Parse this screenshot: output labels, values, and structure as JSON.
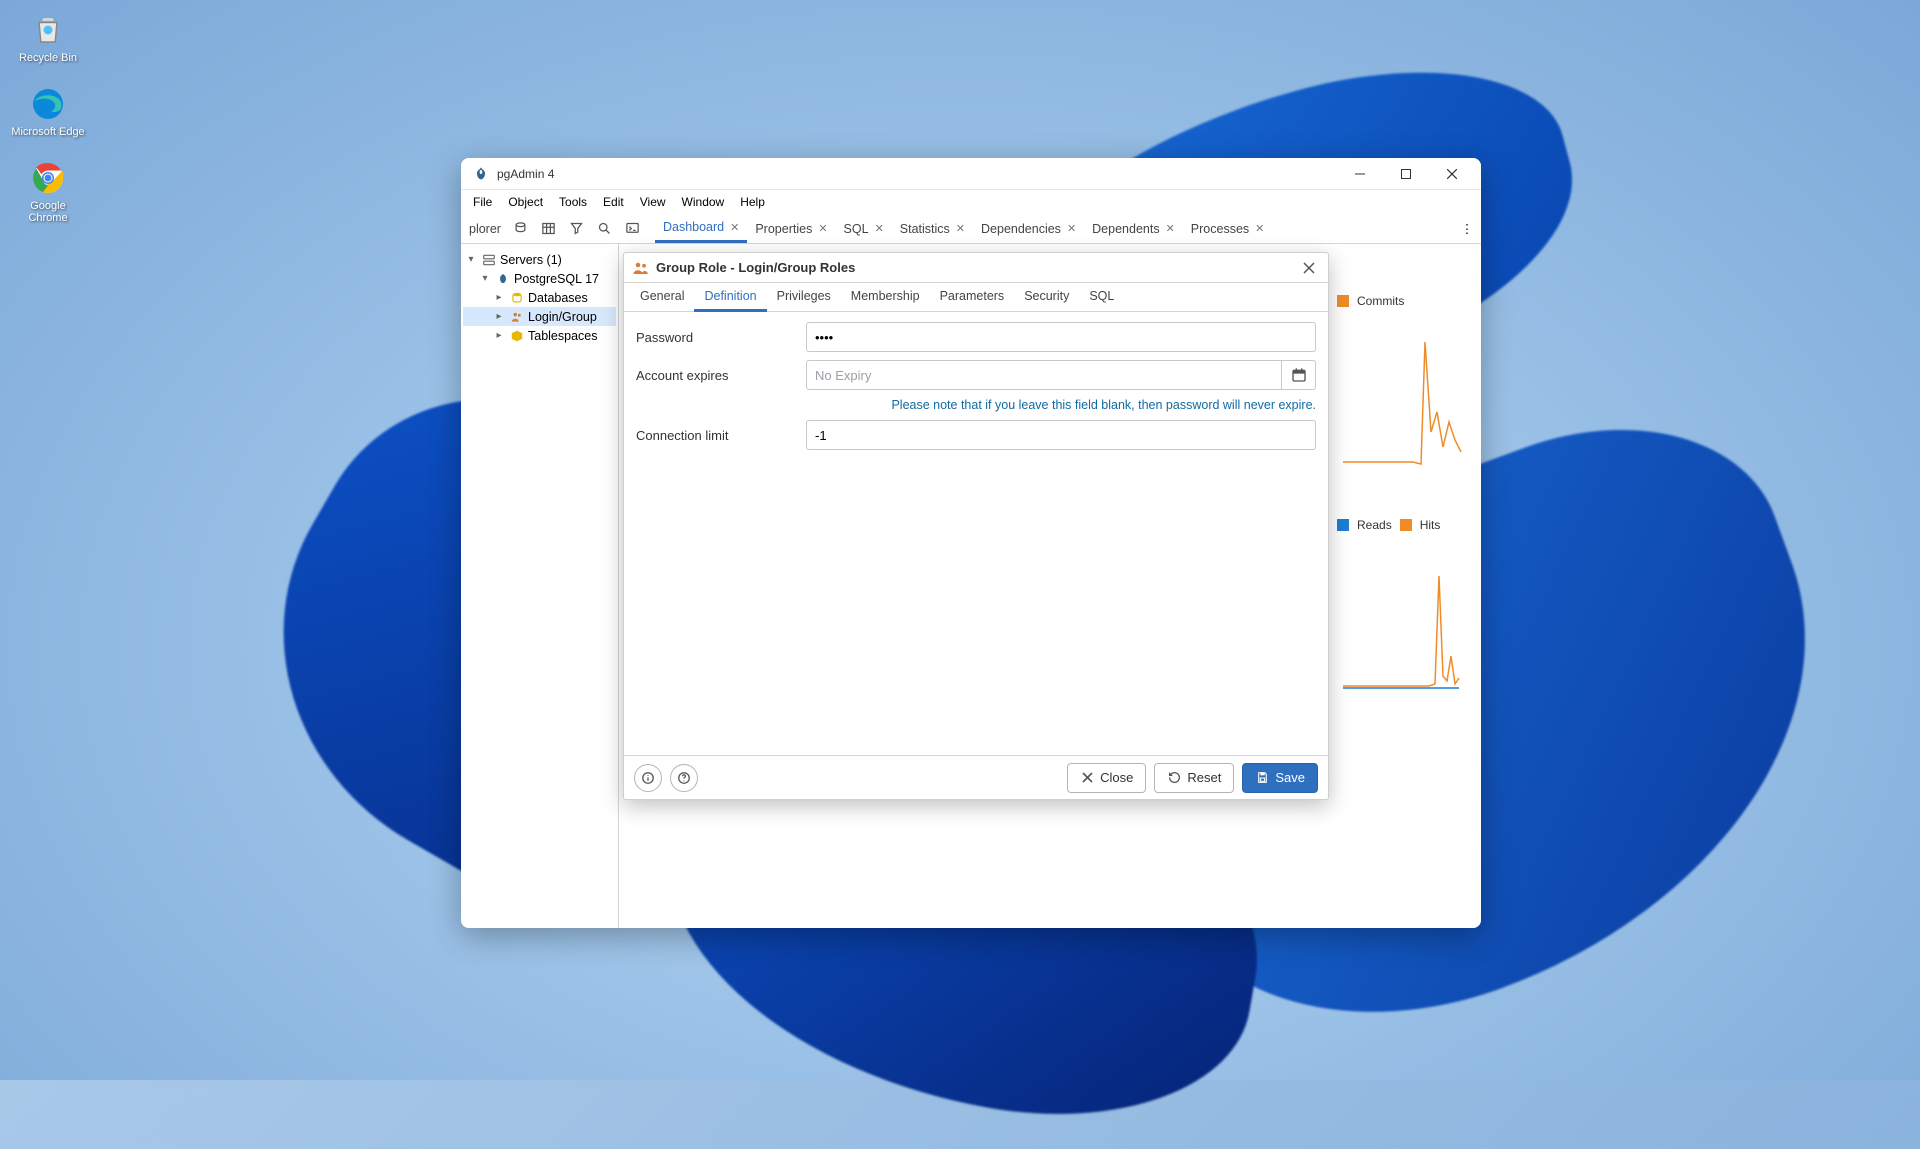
{
  "desktop": {
    "icons": [
      {
        "label": "Recycle Bin",
        "glyph": "🗑️"
      },
      {
        "label": "Microsoft Edge",
        "glyph": "🌐"
      },
      {
        "label": "Google Chrome",
        "glyph": "⭕"
      }
    ]
  },
  "window": {
    "title": "pgAdmin 4",
    "menubar": [
      "File",
      "Object",
      "Tools",
      "Edit",
      "View",
      "Window",
      "Help"
    ],
    "toolbar_label": "plorer",
    "tabs": [
      {
        "label": "Dashboard",
        "active": true
      },
      {
        "label": "Properties",
        "active": false
      },
      {
        "label": "SQL",
        "active": false
      },
      {
        "label": "Statistics",
        "active": false
      },
      {
        "label": "Dependencies",
        "active": false
      },
      {
        "label": "Dependents",
        "active": false
      },
      {
        "label": "Processes",
        "active": false
      }
    ]
  },
  "tree": {
    "root": "Servers (1)",
    "server": "PostgreSQL 17",
    "children": [
      "Databases",
      "Login/Group",
      "Tablespaces"
    ]
  },
  "bg": {
    "legend1": "Commits",
    "legend2a": "Reads",
    "legend2b": "Hits"
  },
  "dialog": {
    "title": "Group Role - Login/Group Roles",
    "tabs": [
      "General",
      "Definition",
      "Privileges",
      "Membership",
      "Parameters",
      "Security",
      "SQL"
    ],
    "active_tab": "Definition",
    "labels": {
      "password": "Password",
      "account_expires": "Account expires",
      "connection_limit": "Connection limit"
    },
    "values": {
      "password": "••••",
      "account_expires_placeholder": "No Expiry",
      "account_expires_value": "",
      "connection_limit": "-1"
    },
    "hint": "Please note that if you leave this field blank, then password will never expire.",
    "buttons": {
      "close": "Close",
      "reset": "Reset",
      "save": "Save"
    }
  },
  "chart_data": [
    {
      "type": "line",
      "title": "",
      "series": [
        {
          "name": "Commits",
          "values": [
            0,
            0,
            0,
            0,
            0,
            0,
            0,
            2,
            80,
            30,
            40,
            20,
            35,
            15
          ]
        }
      ],
      "xlabel": "",
      "ylabel": "",
      "ylim": [
        0,
        100
      ],
      "colors": {
        "Commits": "#f08c28"
      }
    },
    {
      "type": "line",
      "title": "",
      "series": [
        {
          "name": "Reads",
          "values": [
            0,
            0,
            0,
            0,
            0,
            0,
            0,
            0,
            0,
            0,
            0,
            0,
            0,
            0
          ]
        },
        {
          "name": "Hits",
          "values": [
            0,
            0,
            0,
            0,
            0,
            0,
            0,
            0,
            3,
            90,
            12,
            8,
            20,
            8
          ]
        }
      ],
      "xlabel": "",
      "ylabel": "",
      "ylim": [
        0,
        100
      ],
      "colors": {
        "Reads": "#1c7ed6",
        "Hits": "#f08c28"
      }
    }
  ]
}
